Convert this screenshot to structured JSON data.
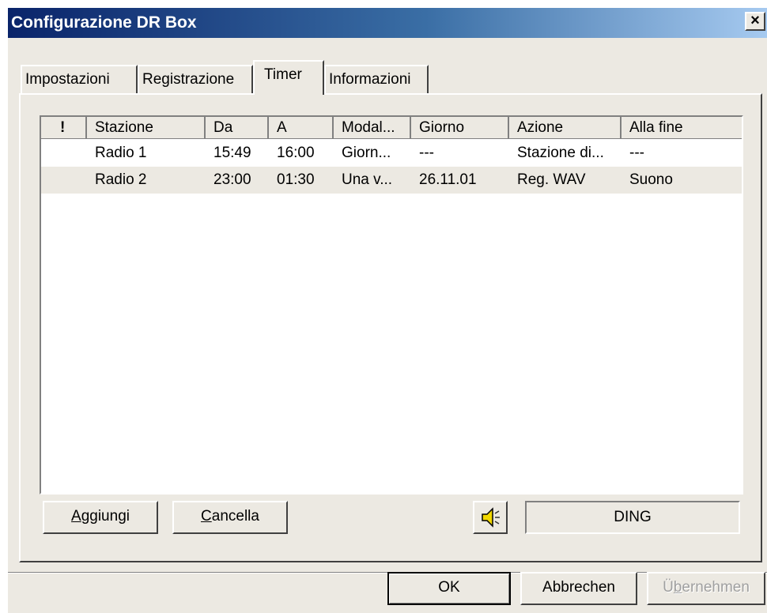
{
  "window": {
    "title": "Configurazione DR Box",
    "close_label": "×"
  },
  "tabs": [
    {
      "label": "Impostazioni"
    },
    {
      "label": "Registrazione"
    },
    {
      "label": "Timer"
    },
    {
      "label": "Informazioni"
    }
  ],
  "active_tab": "Timer",
  "table": {
    "columns": [
      "!",
      "Stazione",
      "Da",
      "A",
      "Modal...",
      "Giorno",
      "Azione",
      "Alla fine"
    ],
    "rows": [
      {
        "flag": "",
        "stazione": "Radio 1",
        "da": "15:49",
        "a": "16:00",
        "modalita": "Giorn...",
        "giorno": "---",
        "azione": "Stazione di...",
        "alla_fine": "---"
      },
      {
        "flag": "",
        "stazione": "Radio 2",
        "da": "23:00",
        "a": "01:30",
        "modalita": "Una v...",
        "giorno": "26.11.01",
        "azione": "Reg. WAV",
        "alla_fine": "Suono"
      }
    ]
  },
  "buttons": {
    "add": {
      "prefix": "",
      "accel": "A",
      "rest": "ggiungi"
    },
    "delete": {
      "prefix": "",
      "accel": "C",
      "rest": "ancella"
    },
    "sound_icon": "speaker-icon",
    "sound_name": "DING",
    "ok": "OK",
    "cancel": "Abbrechen",
    "apply": {
      "prefix": "Ü",
      "accel": "b",
      "rest": "ernehmen"
    }
  },
  "colors": {
    "title_gradient_start": "#0a246a",
    "title_gradient_end": "#a6caf0",
    "face": "#ece9e2"
  }
}
